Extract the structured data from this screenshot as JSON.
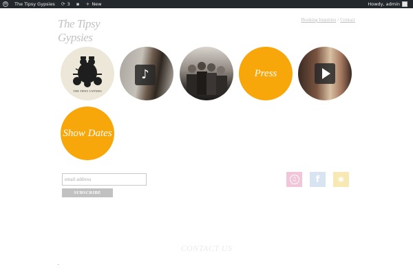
{
  "adminbar": {
    "site_name": "The Tipsy Gypsies",
    "updates_count": "3",
    "new_label": "New",
    "greeting": "Howdy, admin"
  },
  "header": {
    "logo_text": "The Tipsy Gypsies",
    "links": [
      "Booking Inquiries",
      "Contact"
    ],
    "separator": "/"
  },
  "tiles": [
    {
      "label": "",
      "icon": "band-logo-icon"
    },
    {
      "label": "",
      "icon": "music-note-icon"
    },
    {
      "label": "",
      "icon": "band-photo"
    },
    {
      "label": "Press",
      "icon": ""
    },
    {
      "label": "",
      "icon": "video-play-icon"
    },
    {
      "label": "Show Dates",
      "icon": ""
    }
  ],
  "logo_caption": "THE TIPSY GYPSIES",
  "newsletter": {
    "placeholder": "email address",
    "button_label": "SUBSCRIBE"
  },
  "social": [
    {
      "name": "itunes-icon",
      "glyph": "♫"
    },
    {
      "name": "facebook-icon",
      "glyph": "f"
    },
    {
      "name": "reverbnation-icon",
      "glyph": "✺"
    }
  ],
  "footer": {
    "contact_heading": "CONTACT US"
  },
  "colors": {
    "accent": "#f8a70a",
    "adminbar": "#23282d"
  }
}
